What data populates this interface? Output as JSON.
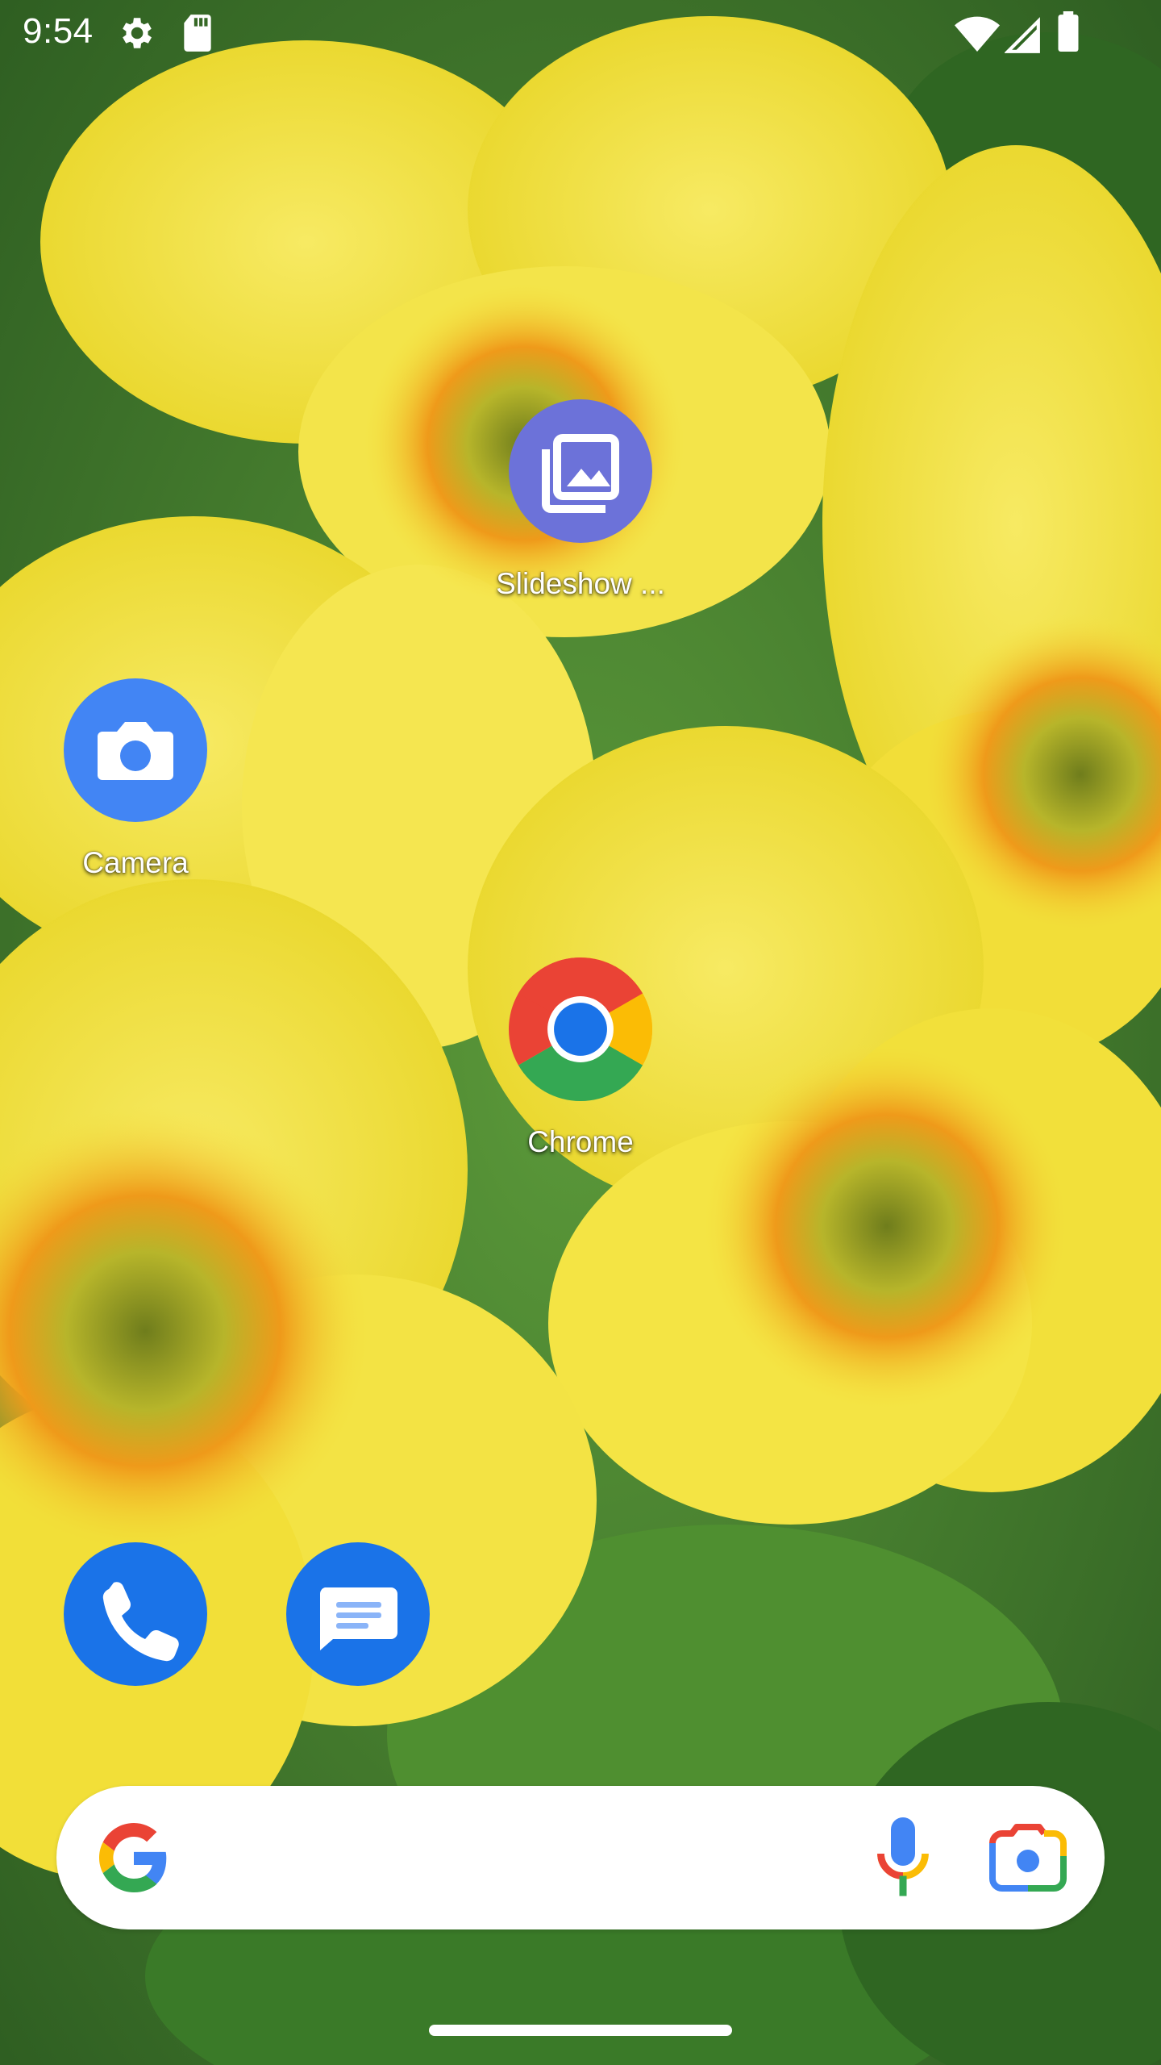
{
  "status_bar": {
    "time": "9:54",
    "left_icons": [
      "settings-gear-icon",
      "sd-card-icon"
    ],
    "right_icons": [
      "wifi-icon",
      "cellular-signal-icon",
      "battery-icon"
    ]
  },
  "wallpaper": {
    "subject": "yellow-primrose-flowers",
    "colors": {
      "petal": "#f4e33c",
      "petal_light": "#f7ea63",
      "center_orange": "#ef9a1a",
      "center_green": "#8a9a22",
      "leaf": "#3d7a2a"
    }
  },
  "apps": [
    {
      "id": "slideshow",
      "label": "Slideshow ...",
      "icon": "slideshow-gallery-icon",
      "color": "#6c72d9"
    },
    {
      "id": "camera",
      "label": "Camera",
      "icon": "camera-icon",
      "color": "#4285f4"
    },
    {
      "id": "chrome",
      "label": "Chrome",
      "icon": "chrome-icon"
    }
  ],
  "dock": [
    {
      "id": "phone",
      "icon": "phone-icon",
      "color": "#1a73e8"
    },
    {
      "id": "messages",
      "icon": "messages-icon",
      "color": "#1a73e8"
    }
  ],
  "search_bar": {
    "icons": [
      "google-g-icon",
      "microphone-icon",
      "google-lens-icon"
    ]
  },
  "colors": {
    "google_blue": "#4285f4",
    "google_red": "#ea4335",
    "google_yellow": "#fbbc05",
    "google_green": "#34a853"
  }
}
